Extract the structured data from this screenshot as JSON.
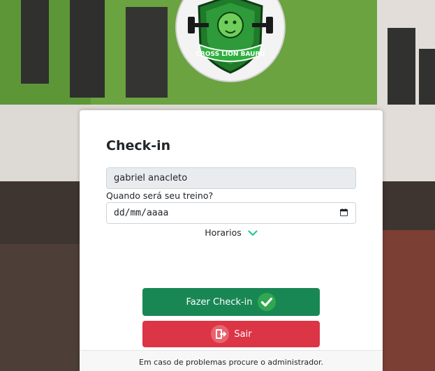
{
  "logo": {
    "text": "CROSS LION BAURU"
  },
  "card": {
    "title": "Check-in",
    "name_value": "gabriel anacleto",
    "date_label": "Quando será seu treino?",
    "date_value": "dd/mm/aaaa",
    "horarios_label": "Horarios",
    "checkin_label": "Fazer Check-in",
    "exit_label": "Sair",
    "footer_text": "Em caso de problemas procure o administrador."
  },
  "icons": {
    "checkin": "check-circle-icon",
    "exit": "door-exit-icon",
    "horarios": "chevron-down-icon",
    "date": "calendar-icon"
  },
  "colors": {
    "success": "#198754",
    "danger": "#dc3545",
    "accent": "#20c997"
  }
}
